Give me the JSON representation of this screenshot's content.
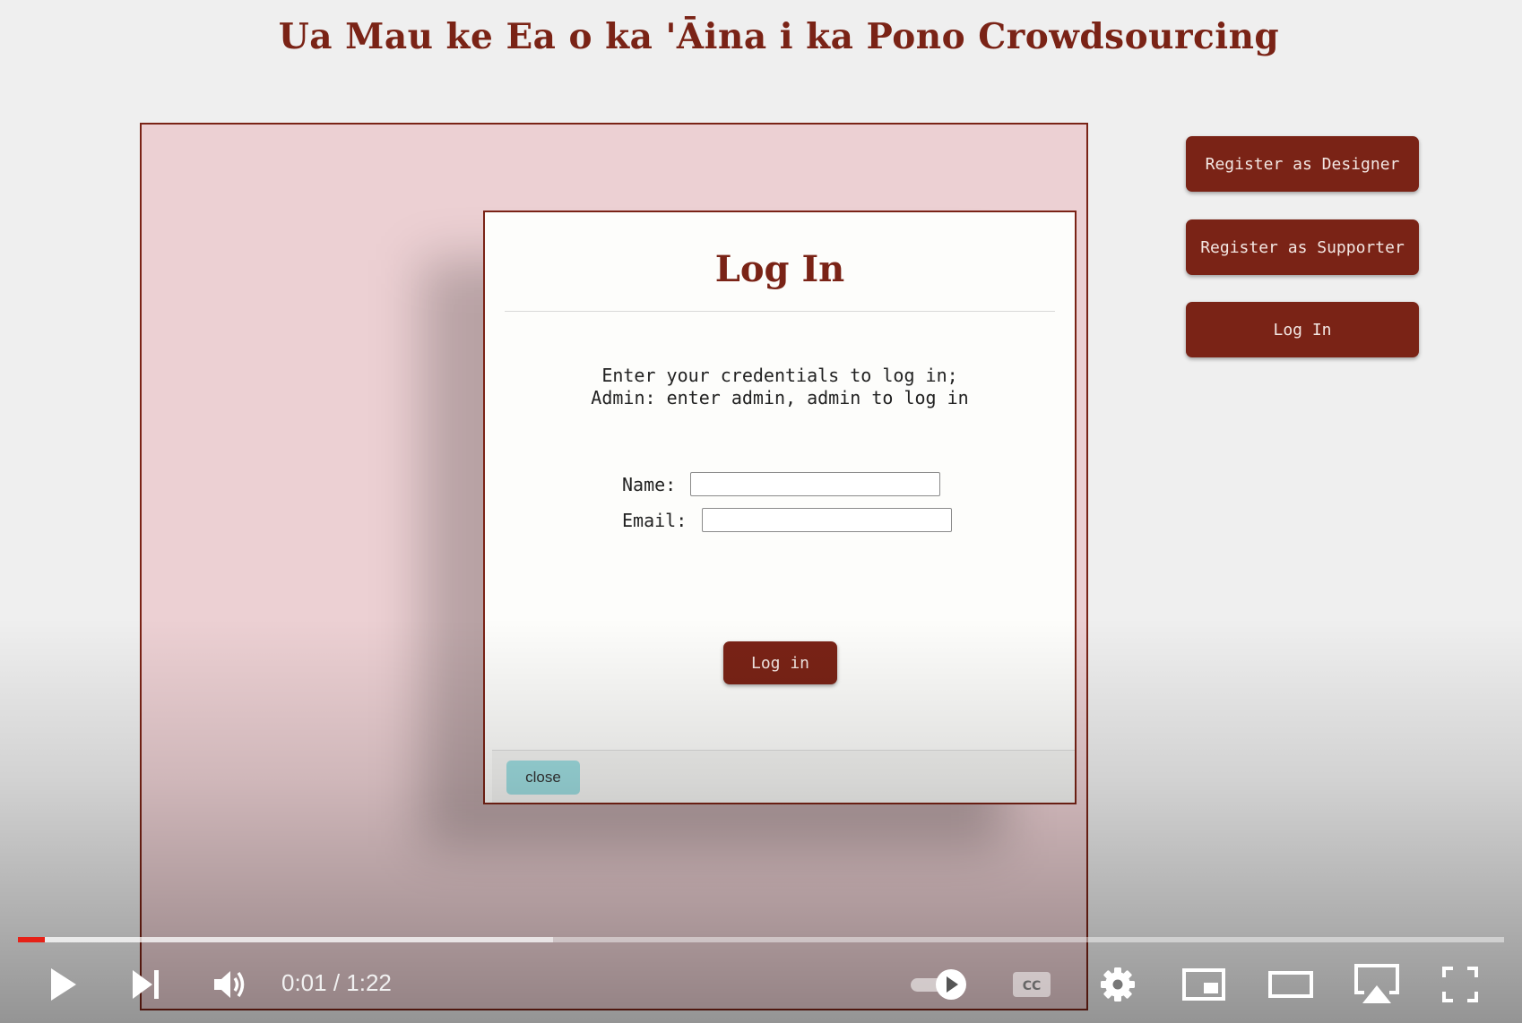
{
  "site": {
    "title": "Ua Mau ke Ea o ka 'Āina i ka Pono Crowdsourcing"
  },
  "sidebar": {
    "register_designer": "Register as Designer",
    "register_supporter": "Register as Supporter",
    "login": "Log In"
  },
  "modal": {
    "title": "Log In",
    "instruction_line1": "Enter your credentials to log in;",
    "instruction_line2": "Admin: enter admin, admin to log in",
    "name_label": "Name:",
    "name_value": "",
    "email_label": "Email:",
    "email_value": "",
    "submit_label": "Log in",
    "close_label": "close"
  },
  "player": {
    "time": "0:01 / 1:22",
    "progress_fraction": 0.018,
    "buffered_fraction": 0.36,
    "accent_color": "#e62117",
    "icons": [
      "play-icon",
      "next-icon",
      "volume-icon",
      "autoplay-toggle-icon",
      "captions-icon",
      "settings-icon",
      "miniplayer-icon",
      "theater-mode-icon",
      "airplay-icon",
      "fullscreen-icon"
    ]
  },
  "colors": {
    "brand": "#7a2316",
    "panel_bg": "#ecd0d3",
    "close_button": "#9edde0"
  }
}
